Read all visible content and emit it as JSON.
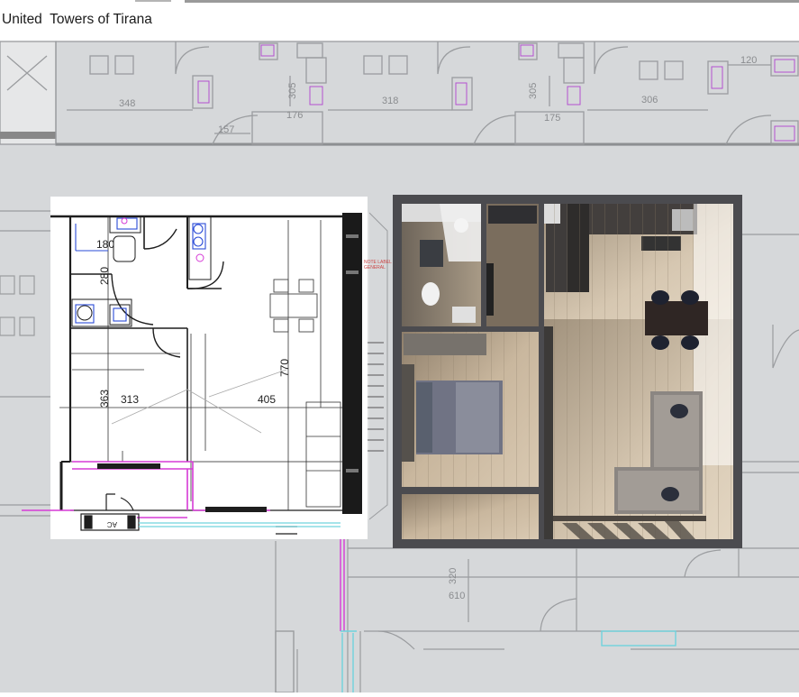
{
  "header": {
    "title": "United  Towers of Tirana"
  },
  "plan": {
    "background_labels": {
      "dim_348": "348",
      "dim_157": "157",
      "dim_305a": "305",
      "dim_176": "176",
      "dim_318": "318",
      "dim_305b": "305",
      "dim_175": "175",
      "dim_306": "306",
      "dim_120": "120",
      "dim_320": "320",
      "dim_610": "610"
    },
    "unit_labels": {
      "dim_180": "180",
      "dim_280": "280",
      "dim_363": "363",
      "dim_313": "313",
      "dim_770": "770",
      "dim_405": "405",
      "ac_label": "AC"
    }
  },
  "colors": {
    "plan_background": "#d6d8da",
    "line_gray": "#9a9c9f",
    "wall_dark": "#1e1e1e",
    "accent_magenta": "#d63ad6",
    "accent_cyan": "#6fd3dd",
    "render_wall": "#4b4b4f",
    "floor_wood": "#b7a48c"
  }
}
